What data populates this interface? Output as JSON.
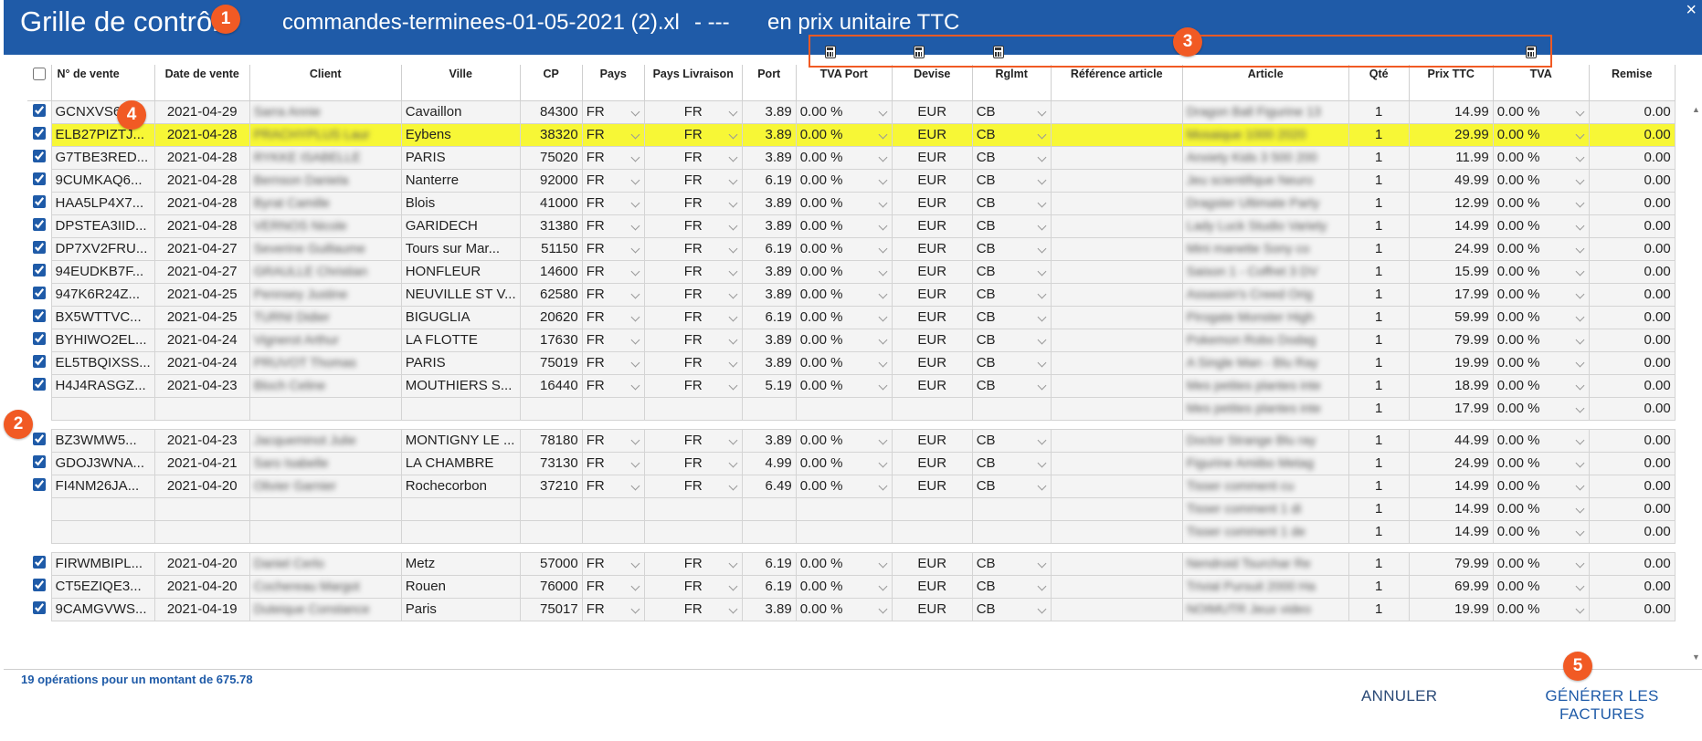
{
  "window": {
    "title": "Grille de contrôle",
    "file": "commandes-terminees-01-05-2021 (2).xl",
    "separator": "- ---",
    "mode": "en prix unitaire TTC",
    "close": "×"
  },
  "callouts": [
    "1",
    "2",
    "3",
    "4",
    "5"
  ],
  "icons": [
    "calculator-icon",
    "calculator-icon",
    "calculator-icon",
    "calculator-icon"
  ],
  "columns": [
    "N° de vente",
    "Date de vente",
    "Client",
    "Ville",
    "CP",
    "Pays",
    "Pays Livraison",
    "Port",
    "TVA Port",
    "Devise",
    "Rglmt",
    "Référence article",
    "Article",
    "Qté",
    "Prix TTC",
    "TVA",
    "Remise"
  ],
  "rows": [
    {
      "checked": true,
      "num": "GCNXVS6Q...",
      "date": "2021-04-29",
      "client": "Sarra Annie",
      "ville": "Cavaillon",
      "cp": "84300",
      "pays": "FR",
      "livr": "FR",
      "port": "3.89",
      "tva_port": "0.00 %",
      "devise": "EUR",
      "rglmt": "CB",
      "ref": "",
      "article": "Dragon Ball Figurine 13",
      "qte": "1",
      "prix": "14.99",
      "tva": "0.00 %",
      "remise": "0.00"
    },
    {
      "checked": true,
      "num": "ELB27PIZTJ...",
      "date": "2021-04-28",
      "client": "PRACHYPLUS Laur",
      "ville": "Eybens",
      "cp": "38320",
      "pays": "FR",
      "livr": "FR",
      "port": "3.89",
      "tva_port": "0.00 %",
      "devise": "EUR",
      "rglmt": "CB",
      "ref": "",
      "article": "Mosaique 1000 2020",
      "qte": "1",
      "prix": "29.99",
      "tva": "0.00 %",
      "remise": "0.00",
      "highlight": true
    },
    {
      "checked": true,
      "num": "G7TBE3RED...",
      "date": "2021-04-28",
      "client": "RYKKE ISABELLE",
      "ville": "PARIS",
      "cp": "75020",
      "pays": "FR",
      "livr": "FR",
      "port": "3.89",
      "tva_port": "0.00 %",
      "devise": "EUR",
      "rglmt": "CB",
      "ref": "",
      "article": "Anxiety Kids 3 500 200",
      "qte": "1",
      "prix": "11.99",
      "tva": "0.00 %",
      "remise": "0.00"
    },
    {
      "checked": true,
      "num": "9CUMKAQ6...",
      "date": "2021-04-28",
      "client": "Bernson Daniela",
      "ville": "Nanterre",
      "cp": "92000",
      "pays": "FR",
      "livr": "FR",
      "port": "6.19",
      "tva_port": "0.00 %",
      "devise": "EUR",
      "rglmt": "CB",
      "ref": "",
      "article": "Jeu scientifique Neuro",
      "qte": "1",
      "prix": "49.99",
      "tva": "0.00 %",
      "remise": "0.00"
    },
    {
      "checked": true,
      "num": "HAA5LP4X7...",
      "date": "2021-04-28",
      "client": "Byrat Camille",
      "ville": "Blois",
      "cp": "41000",
      "pays": "FR",
      "livr": "FR",
      "port": "3.89",
      "tva_port": "0.00 %",
      "devise": "EUR",
      "rglmt": "CB",
      "ref": "",
      "article": "Dragster Ultimate Party",
      "qte": "1",
      "prix": "12.99",
      "tva": "0.00 %",
      "remise": "0.00"
    },
    {
      "checked": true,
      "num": "DPSTEA3IID...",
      "date": "2021-04-28",
      "client": "VERNOS Nicole",
      "ville": "GARIDECH",
      "cp": "31380",
      "pays": "FR",
      "livr": "FR",
      "port": "3.89",
      "tva_port": "0.00 %",
      "devise": "EUR",
      "rglmt": "CB",
      "ref": "",
      "article": "Lady Luck Studio Variety",
      "qte": "1",
      "prix": "14.99",
      "tva": "0.00 %",
      "remise": "0.00"
    },
    {
      "checked": true,
      "num": "DP7XV2FRU...",
      "date": "2021-04-27",
      "client": "Severine Guillaume",
      "ville": "Tours sur Mar...",
      "cp": "51150",
      "pays": "FR",
      "livr": "FR",
      "port": "6.19",
      "tva_port": "0.00 %",
      "devise": "EUR",
      "rglmt": "CB",
      "ref": "",
      "article": "Mini manette Sony co",
      "qte": "1",
      "prix": "24.99",
      "tva": "0.00 %",
      "remise": "0.00"
    },
    {
      "checked": true,
      "num": "94EUDKB7F...",
      "date": "2021-04-27",
      "client": "GRAULLE Christian",
      "ville": "HONFLEUR",
      "cp": "14600",
      "pays": "FR",
      "livr": "FR",
      "port": "3.89",
      "tva_port": "0.00 %",
      "devise": "EUR",
      "rglmt": "CB",
      "ref": "",
      "article": "Saison 1 - Coffret 3 DV",
      "qte": "1",
      "prix": "15.99",
      "tva": "0.00 %",
      "remise": "0.00"
    },
    {
      "checked": true,
      "num": "947K6R24Z...",
      "date": "2021-04-25",
      "client": "Pennsey Justine",
      "ville": "NEUVILLE ST V...",
      "cp": "62580",
      "pays": "FR",
      "livr": "FR",
      "port": "3.89",
      "tva_port": "0.00 %",
      "devise": "EUR",
      "rglmt": "CB",
      "ref": "",
      "article": "Assassin's Creed Orig",
      "qte": "1",
      "prix": "17.99",
      "tva": "0.00 %",
      "remise": "0.00"
    },
    {
      "checked": true,
      "num": "BX5WTTVC...",
      "date": "2021-04-25",
      "client": "TURNI Didier",
      "ville": "BIGUGLIA",
      "cp": "20620",
      "pays": "FR",
      "livr": "FR",
      "port": "6.19",
      "tva_port": "0.00 %",
      "devise": "EUR",
      "rglmt": "CB",
      "ref": "",
      "article": "Pirogate Monster High",
      "qte": "1",
      "prix": "59.99",
      "tva": "0.00 %",
      "remise": "0.00"
    },
    {
      "checked": true,
      "num": "BYHIWO2EL...",
      "date": "2021-04-24",
      "client": "Vignerot Arthur",
      "ville": "LA FLOTTE",
      "cp": "17630",
      "pays": "FR",
      "livr": "FR",
      "port": "3.89",
      "tva_port": "0.00 %",
      "devise": "EUR",
      "rglmt": "CB",
      "ref": "",
      "article": "Pokemon Robo Dodag",
      "qte": "1",
      "prix": "79.99",
      "tva": "0.00 %",
      "remise": "0.00"
    },
    {
      "checked": true,
      "num": "EL5TBQIXSS...",
      "date": "2021-04-24",
      "client": "PRUVOT Thomas",
      "ville": "PARIS",
      "cp": "75019",
      "pays": "FR",
      "livr": "FR",
      "port": "3.89",
      "tva_port": "0.00 %",
      "devise": "EUR",
      "rglmt": "CB",
      "ref": "",
      "article": "A Single Man - Blu Ray",
      "qte": "1",
      "prix": "19.99",
      "tva": "0.00 %",
      "remise": "0.00"
    },
    {
      "checked": true,
      "num": "H4J4RASGZ...",
      "date": "2021-04-23",
      "client": "Bloch Celine",
      "ville": "MOUTHIERS S...",
      "cp": "16440",
      "pays": "FR",
      "livr": "FR",
      "port": "5.19",
      "tva_port": "0.00 %",
      "devise": "EUR",
      "rglmt": "CB",
      "ref": "",
      "article": "Mes petites plantes inte",
      "qte": "1",
      "prix": "18.99",
      "tva": "0.00 %",
      "remise": "0.00"
    },
    {
      "sub": true,
      "article": "Mes petites plantes inte",
      "qte": "1",
      "prix": "17.99",
      "tva": "0.00 %",
      "remise": "0.00"
    },
    {
      "spacer": true
    },
    {
      "checked": true,
      "num": "BZ3WMW5...",
      "date": "2021-04-23",
      "client": "Jacqueminot Julie",
      "ville": "MONTIGNY LE ...",
      "cp": "78180",
      "pays": "FR",
      "livr": "FR",
      "port": "3.89",
      "tva_port": "0.00 %",
      "devise": "EUR",
      "rglmt": "CB",
      "ref": "",
      "article": "Doctor Strange Blu ray",
      "qte": "1",
      "prix": "44.99",
      "tva": "0.00 %",
      "remise": "0.00"
    },
    {
      "checked": true,
      "num": "GDOJ3WNA...",
      "date": "2021-04-21",
      "client": "Saro Isabelle",
      "ville": "LA CHAMBRE",
      "cp": "73130",
      "pays": "FR",
      "livr": "FR",
      "port": "4.99",
      "tva_port": "0.00 %",
      "devise": "EUR",
      "rglmt": "CB",
      "ref": "",
      "article": "Figurine Amiibo Metag",
      "qte": "1",
      "prix": "24.99",
      "tva": "0.00 %",
      "remise": "0.00"
    },
    {
      "checked": true,
      "num": "FI4NM26JA...",
      "date": "2021-04-20",
      "client": "Olivier Garnier",
      "ville": "Rochecorbon",
      "cp": "37210",
      "pays": "FR",
      "livr": "FR",
      "port": "6.49",
      "tva_port": "0.00 %",
      "devise": "EUR",
      "rglmt": "CB",
      "ref": "",
      "article": "Tisser comment cu",
      "qte": "1",
      "prix": "14.99",
      "tva": "0.00 %",
      "remise": "0.00"
    },
    {
      "sub": true,
      "article": "Tisser comment 1 di",
      "qte": "1",
      "prix": "14.99",
      "tva": "0.00 %",
      "remise": "0.00"
    },
    {
      "sub": true,
      "article": "Tisser comment 1 de",
      "qte": "1",
      "prix": "14.99",
      "tva": "0.00 %",
      "remise": "0.00"
    },
    {
      "spacer": true
    },
    {
      "checked": true,
      "num": "FIRWMBIPL...",
      "date": "2021-04-20",
      "client": "Daniel Cerlo",
      "ville": "Metz",
      "cp": "57000",
      "pays": "FR",
      "livr": "FR",
      "port": "6.19",
      "tva_port": "0.00 %",
      "devise": "EUR",
      "rglmt": "CB",
      "ref": "",
      "article": "Nendroid Tsurchar Re",
      "qte": "1",
      "prix": "79.99",
      "tva": "0.00 %",
      "remise": "0.00"
    },
    {
      "checked": true,
      "num": "CT5EZIQE3...",
      "date": "2021-04-20",
      "client": "Cochereau Margot",
      "ville": "Rouen",
      "cp": "76000",
      "pays": "FR",
      "livr": "FR",
      "port": "6.19",
      "tva_port": "0.00 %",
      "devise": "EUR",
      "rglmt": "CB",
      "ref": "",
      "article": "Trivial Pursuit 2000 Ha",
      "qte": "1",
      "prix": "69.99",
      "tva": "0.00 %",
      "remise": "0.00"
    },
    {
      "checked": true,
      "num": "9CAMGVWS...",
      "date": "2021-04-19",
      "client": "Duteique Constance",
      "ville": "Paris",
      "cp": "75017",
      "pays": "FR",
      "livr": "FR",
      "port": "3.89",
      "tva_port": "0.00 %",
      "devise": "EUR",
      "rglmt": "CB",
      "ref": "",
      "article": "NOIMUTR Jeux video",
      "qte": "1",
      "prix": "19.99",
      "tva": "0.00 %",
      "remise": "0.00"
    }
  ],
  "footer": {
    "summary": "19 opérations pour un montant de 675.78",
    "cancel": "ANNULER",
    "generate": "GÉNÉRER LES FACTURES"
  },
  "colors": {
    "titlebar": "#1f5ba8",
    "highlight": "#f7f736",
    "callout": "#f15a24"
  }
}
